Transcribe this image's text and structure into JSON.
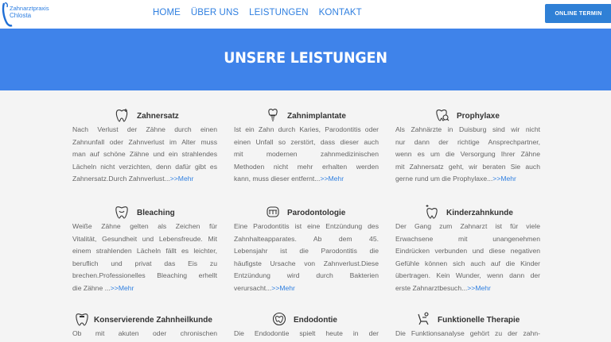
{
  "header": {
    "logo_line1": "Zahnarztpraxis",
    "logo_line2": "Chlosta",
    "nav": [
      "HOME",
      "ÜBER UNS",
      "LEISTUNGEN",
      "KONTAKT"
    ],
    "cta_label": "ONLINE TERMIN"
  },
  "banner": {
    "title": "UNSERE LEISTUNGEN"
  },
  "colors": {
    "accent": "#3f83ea",
    "link": "#2f7fe0",
    "background": "#f4f4f4"
  },
  "more_label": ">>Mehr",
  "services": [
    {
      "title": "Zahnersatz",
      "icon": "implant-plus-tooth-icon",
      "lines": [
        "Nach Verlust der Zähne durch einen",
        "Zahnunfall oder Zahnverlust im Alter muss",
        "man auf schöne Zähne und ein strahlendes",
        "Lächeln nicht verzichten, denn dafür gibt es",
        "Zahnersatz.Durch Zahnverlust..."
      ]
    },
    {
      "title": "Zahnimplantate",
      "icon": "tooth-implant-icon",
      "lines": [
        "Ist ein Zahn durch Karies, Parodontitis oder",
        "einen Unfall so zerstört, dass dieser auch",
        "mit modernen zahnmedizinischen",
        "Methoden nicht mehr erhalten werden",
        "kann, muss dieser entfernt..."
      ]
    },
    {
      "title": "Prophylaxe",
      "icon": "tooth-search-icon",
      "lines": [
        "Als Zahnärzte in Duisburg sind wir nicht",
        "nur dann der richtige Ansprechpartner,",
        "wenn es um die Versorgung Ihrer Zähne",
        "mit Zahnersatz geht, wir beraten Sie auch",
        "gerne rund um die Prophylaxe..."
      ]
    },
    {
      "title": "Bleaching",
      "icon": "tooth-smile-icon",
      "lines": [
        "Weiße Zähne gelten als Zeichen für",
        "Vitalität, Gesundheit und Lebensfreude. Mit",
        "einem strahlenden Lächeln fällt es leichter,",
        "beruflich und privat das Eis zu",
        "brechen.Professionelles Bleaching erhellt",
        "die Zähne ..."
      ]
    },
    {
      "title": "Parodontologie",
      "icon": "gum-icon",
      "lines": [
        "Eine Parodontitis ist eine Entzündung des",
        "Zahnhalteapparates. Ab dem 45.",
        "Lebensjahr ist die Parodontitis die",
        "häufigste Ursache von Zahnverlust.Diese",
        "Entzündung wird durch Bakterien",
        "verursacht..."
      ]
    },
    {
      "title": "Kinderzahnkunde",
      "icon": "tooth-sparkle-icon",
      "lines": [
        "Der Gang zum Zahnarzt ist für viele",
        "Erwachsene mit unangenehmen",
        "Eindrücken verbunden und diese negativen",
        "Gefühle können sich auch auf die Kinder",
        "übertragen. Kein Wunder, wenn dann der",
        "erste Zahnarztbesuch..."
      ]
    },
    {
      "title": "Konservierende Zahnheilkunde",
      "icon": "tooth-filling-icon",
      "lines": [
        "Ob mit akuten oder chronischen"
      ]
    },
    {
      "title": "Endodontie",
      "icon": "root-canal-icon",
      "lines": [
        "Die Endodontie spielt heute in der"
      ]
    },
    {
      "title": "Funktionelle Therapie",
      "icon": "dental-chair-icon",
      "lines": [
        "Die Funktionsanalyse gehört zu der zahn-"
      ]
    }
  ]
}
